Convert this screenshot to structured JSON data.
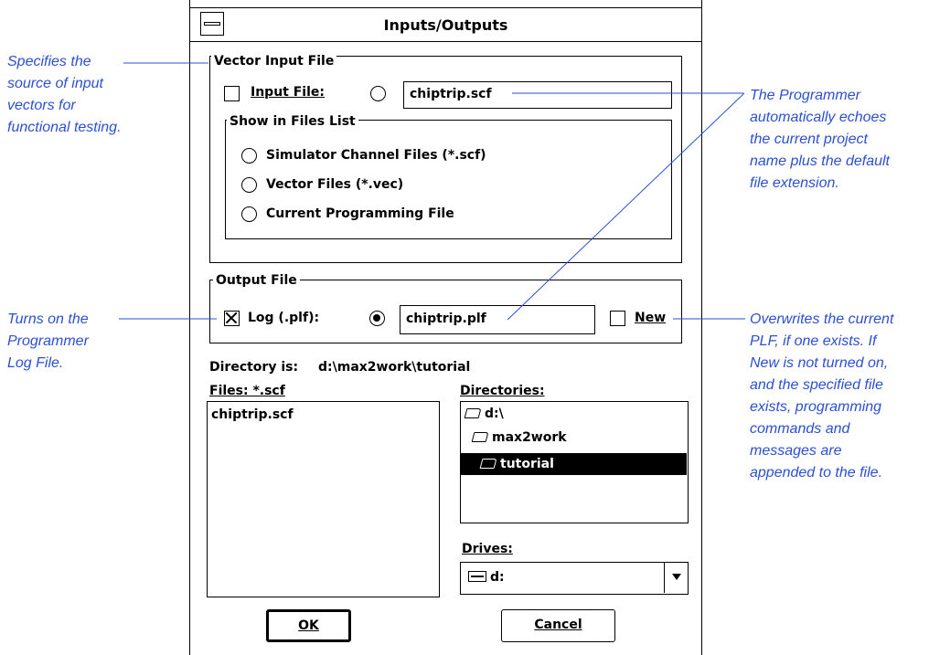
{
  "dialog": {
    "title": "Inputs/Outputs",
    "vector_input": {
      "group_label": "Vector Input File",
      "input_file_label": "Input File:",
      "input_file_checked": false,
      "input_file_value": "chiptrip.scf",
      "show_group_label": "Show in Files List",
      "options": [
        "Simulator Channel Files (*.scf)",
        "Vector Files (*.vec)",
        "Current Programming File"
      ]
    },
    "output_file": {
      "group_label": "Output File",
      "log_label": "Log (.plf):",
      "log_checked": true,
      "log_value": "chiptrip.plf",
      "new_label": "New",
      "new_checked": false
    },
    "directory": {
      "label": "Directory is:",
      "value": "d:\\max2work\\tutorial"
    },
    "files": {
      "label": "Files: *.scf",
      "items": [
        "chiptrip.scf"
      ]
    },
    "directories": {
      "label": "Directories:",
      "items": [
        "d:\\",
        "max2work",
        "tutorial"
      ],
      "selected": "tutorial"
    },
    "drives": {
      "label": "Drives:",
      "value": "d:"
    },
    "buttons": {
      "ok": "OK",
      "cancel": "Cancel"
    }
  },
  "annotations": {
    "vector_source": [
      "Specifies the",
      "source of input",
      "vectors for",
      "functional testing."
    ],
    "echo": [
      "The Programmer",
      "automatically echoes",
      "the current project",
      "name plus the default",
      "file extension."
    ],
    "log": [
      "Turns on the",
      "Programmer",
      "Log File."
    ],
    "overwrite": [
      "Overwrites the current",
      "PLF, if one exists. If",
      "New is not turned on,",
      "and the specified file",
      "exists, programming",
      "commands and",
      "messages are",
      "appended to the file."
    ]
  },
  "colors": {
    "annotation": "#2b4fd6",
    "leader_line": "#2b4fd6"
  }
}
